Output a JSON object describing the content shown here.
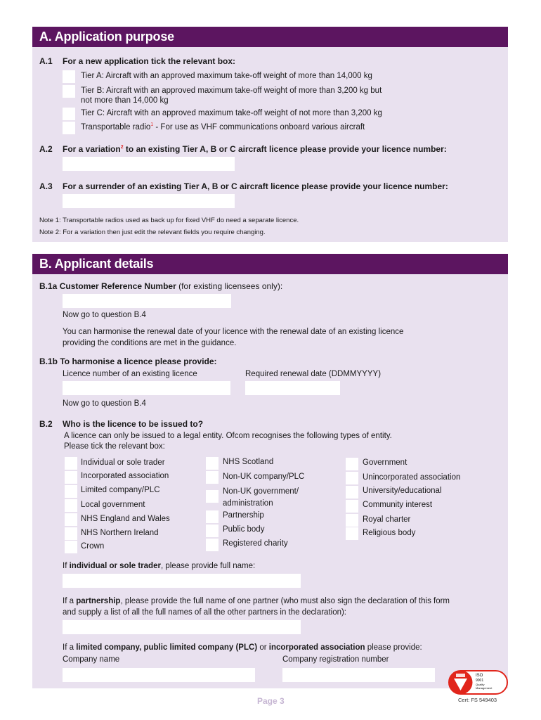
{
  "sectionA": {
    "title": "A. Application purpose",
    "a1": {
      "num": "A.1",
      "label": "For a new application tick the relevant box:",
      "options": [
        {
          "line1": "Tier A: Aircraft with an approved maximum take-off weight of more than 14,000 kg",
          "checked": false
        },
        {
          "line1": "Tier B: Aircraft with an approved maximum take-off weight of more than 3,200 kg but",
          "line2": "not more than 14,000 kg",
          "checked": false
        },
        {
          "line1": "Tier C: Aircraft with an approved maximum take-off weight of not more than 3,200 kg",
          "checked": false
        },
        {
          "line1a": "Transportable radio",
          "sup": "1",
          "line1b": " - For use as VHF communications onboard various aircraft",
          "checked": false
        }
      ]
    },
    "a2": {
      "num": "A.2",
      "label_a": "For a variation",
      "sup": "2",
      "label_b": " to an existing Tier A, B or C aircraft licence please provide your licence number:",
      "value": ""
    },
    "a3": {
      "num": "A.3",
      "label": "For a surrender of an existing Tier A, B or C aircraft licence please provide your licence number:",
      "value": ""
    },
    "notes": [
      "Note 1: Transportable radios used as back up for fixed VHF do need a separate licence.",
      "Note 2: For a variation then just edit the relevant fields you require changing."
    ]
  },
  "sectionB": {
    "title": "B. Applicant details",
    "b1a": {
      "num": "B.1a",
      "label_bold": "Customer Reference Number",
      "label_rest": " (for existing licensees only):",
      "value": "",
      "goto": "Now go to question B.4",
      "harmonise_line1": "You can harmonise the renewal date of your licence with the renewal date of an existing licence",
      "harmonise_line2": "providing the conditions are met in the guidance."
    },
    "b1b": {
      "num": "B.1b",
      "label": "To harmonise a licence please provide:",
      "field1_label": "Licence number of an existing licence",
      "field1_value": "",
      "field2_label": "Required renewal date (DDMMYYYY)",
      "field2_value": "",
      "goto": "Now go to question B.4"
    },
    "b2": {
      "num": "B.2",
      "label": "Who is the licence to be issued to?",
      "intro1": "A licence can only be issued to a legal entity. Ofcom recognises the following types of entity.",
      "intro2": "Please tick the relevant box:",
      "col1": [
        "Individual or sole trader",
        "Incorporated association",
        "Limited company/PLC",
        "Local government",
        "NHS England and Wales",
        "NHS Northern Ireland",
        "Crown"
      ],
      "col2": [
        "NHS Scotland",
        "Non-UK company/PLC",
        "Non-UK government/",
        "administration",
        "Partnership",
        "Public body",
        "Registered charity"
      ],
      "col3": [
        "Government",
        "Unincorporated association",
        "University/educational",
        "Community interest",
        "Royal charter",
        "Religious body"
      ]
    },
    "individual": {
      "pre": "If ",
      "bold": "individual or sole trader",
      "post": ", please provide full name:",
      "value": ""
    },
    "partnership": {
      "pre": "If a ",
      "bold": "partnership",
      "post": ", please provide the full name of one partner (who must also sign the declaration of this form",
      "line2": "and supply a list of all the full names of all the other partners in the declaration):",
      "value": ""
    },
    "company": {
      "pre": "If a ",
      "bold1": "limited company, public limited company (PLC)",
      "mid": " or ",
      "bold2": "incorporated association",
      "post": " please provide:",
      "name_label": "Company name",
      "name_value": "",
      "reg_label": "Company registration number",
      "reg_value": ""
    }
  },
  "footer": {
    "page": "Page 3",
    "cert": "Cert: FS 549403",
    "iso_lines": [
      "ISO",
      "9001",
      "Quality",
      "Management"
    ],
    "bsi": "bsi"
  }
}
